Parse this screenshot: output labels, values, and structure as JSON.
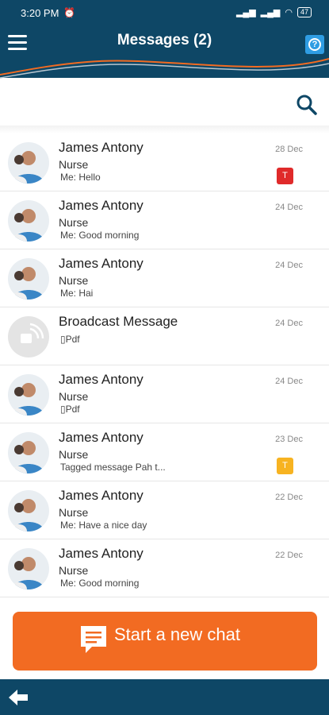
{
  "status_bar": {
    "time": "3:20 PM",
    "battery": "47"
  },
  "header": {
    "title": "Messages (2)",
    "help_label": "?"
  },
  "colors": {
    "primary": "#0e4766",
    "accent": "#f26b22",
    "tag_red": "#e02a2a",
    "tag_yellow": "#f7b321"
  },
  "messages": [
    {
      "name": "James Antony",
      "role": "Nurse",
      "preview": "Me:  Hello",
      "date": "28 Dec",
      "tag": "T",
      "tag_color": "red"
    },
    {
      "name": "James Antony",
      "role": "Nurse",
      "preview": "Me:  Good morning",
      "date": "24 Dec"
    },
    {
      "name": "James Antony",
      "role": "Nurse",
      "preview": "Me:  Hai",
      "date": "24 Dec"
    },
    {
      "name": "Broadcast Message",
      "role": "",
      "preview": "Pdf",
      "date": "24 Dec"
    },
    {
      "name": "James Antony",
      "role": "Nurse",
      "preview": "Pdf",
      "date": "24 Dec"
    },
    {
      "name": "James Antony",
      "role": "Nurse",
      "preview": "Tagged message Pah t...",
      "date": "23 Dec",
      "tag": "T",
      "tag_color": "yellow"
    },
    {
      "name": "James Antony",
      "role": "Nurse",
      "preview": "Me:  Have a nice day",
      "date": "22 Dec"
    },
    {
      "name": "James Antony",
      "role": "Nurse",
      "preview": "Me:  Good morning",
      "date": "22 Dec"
    }
  ],
  "start_chat": {
    "label": "Start a new chat"
  }
}
